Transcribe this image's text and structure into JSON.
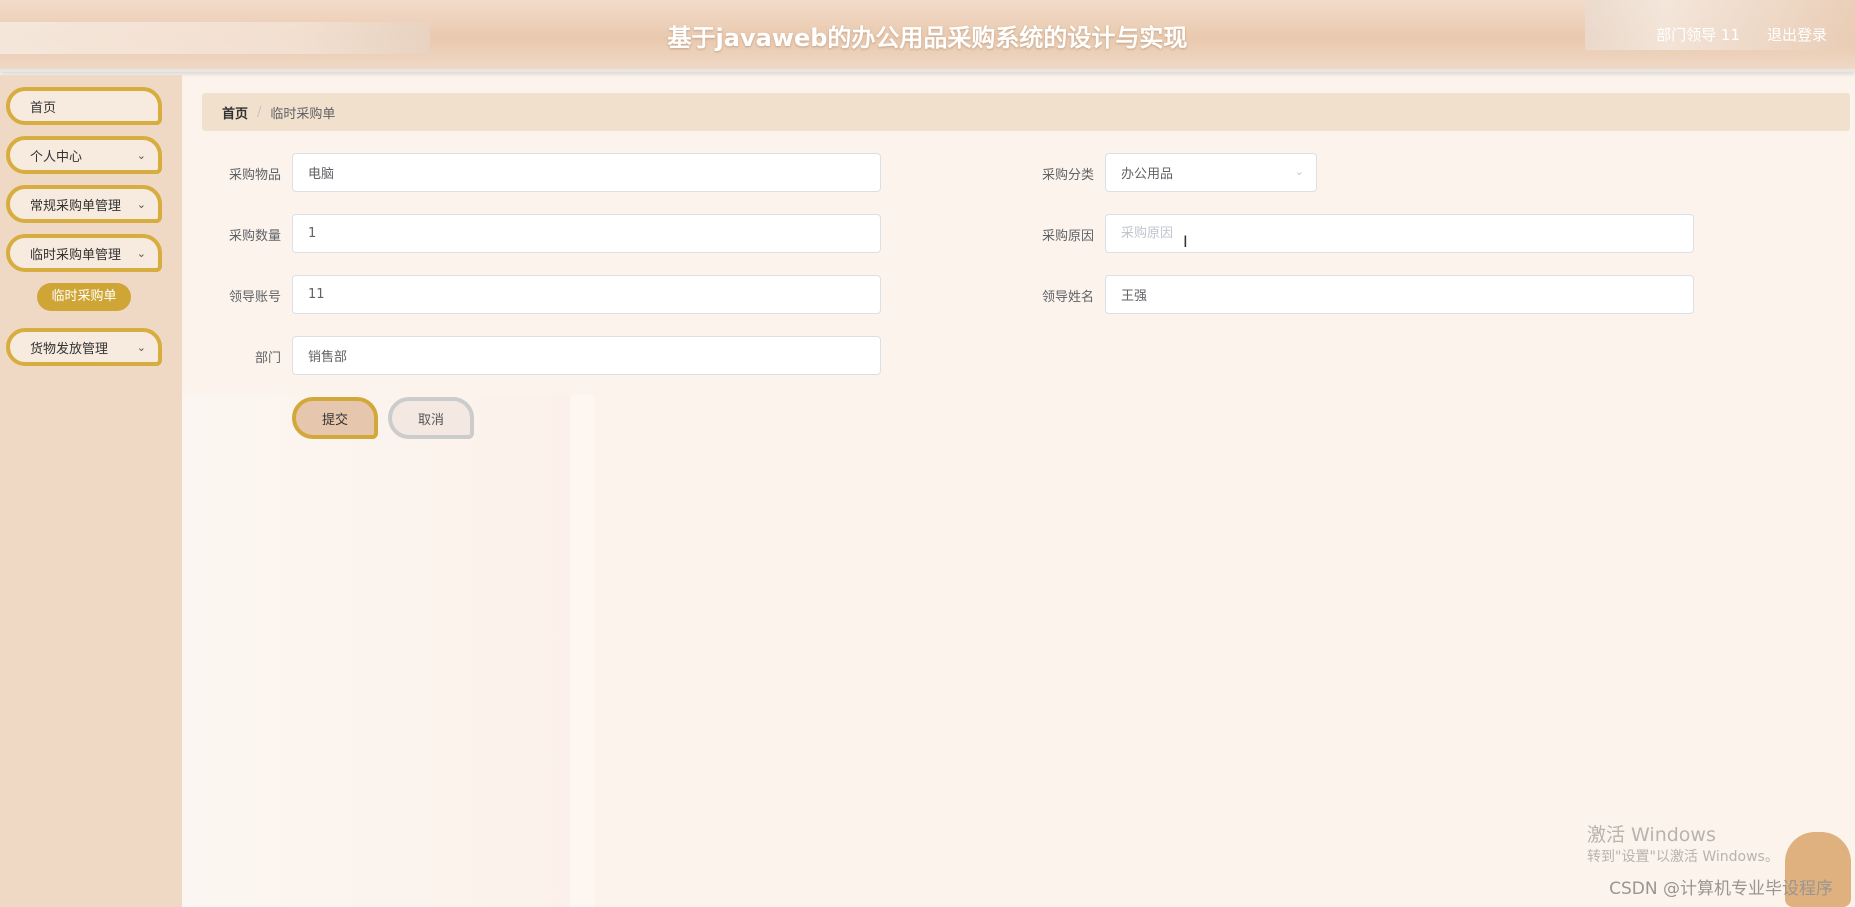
{
  "header": {
    "title": "基于javaweb的办公用品采购系统的设计与实现",
    "user_label": "部门领导 11",
    "logout_label": "退出登录"
  },
  "sidebar": {
    "items": [
      {
        "label": "首页",
        "has_submenu": false
      },
      {
        "label": "个人中心",
        "has_submenu": true
      },
      {
        "label": "常规采购单管理",
        "has_submenu": true
      },
      {
        "label": "临时采购单管理",
        "has_submenu": true,
        "expanded": true
      },
      {
        "label": "货物发放管理",
        "has_submenu": true
      }
    ],
    "active_subitem": "临时采购单",
    "chevron_icon": "chevron-down-icon"
  },
  "breadcrumb": {
    "home": "首页",
    "separator": "/",
    "current": "临时采购单"
  },
  "form": {
    "item_label": "采购物品",
    "item_value": "电脑",
    "category_label": "采购分类",
    "category_value": "办公用品",
    "quantity_label": "采购数量",
    "quantity_value": "1",
    "reason_label": "采购原因",
    "reason_placeholder": "采购原因",
    "leader_account_label": "领导账号",
    "leader_account_value": "11",
    "leader_name_label": "领导姓名",
    "leader_name_value": "王强",
    "department_label": "部门",
    "department_value": "销售部",
    "submit_label": "提交",
    "cancel_label": "取消"
  },
  "overlay": {
    "windows_watermark_title": "激活 Windows",
    "windows_watermark_sub": "转到\"设置\"以激活 Windows。",
    "csdn_watermark": "CSDN @计算机专业毕设程序"
  },
  "colors": {
    "accent_gold": "#d6ad3e",
    "header_bg": "#e9c9ae",
    "sidebar_bg": "#efd9c4",
    "active_sub_bg": "#cfa536"
  }
}
